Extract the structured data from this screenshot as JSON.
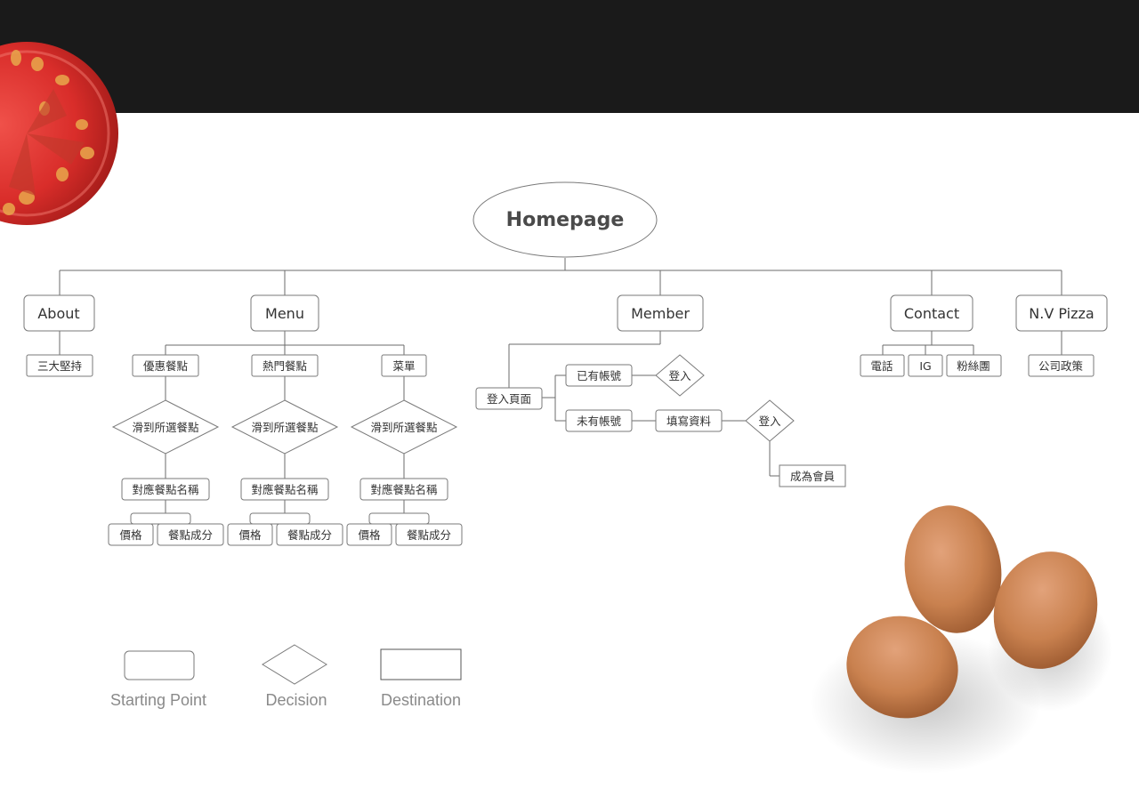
{
  "title": "Homepage",
  "top_nav": [
    {
      "key": "about",
      "label": "About"
    },
    {
      "key": "menu",
      "label": "Menu"
    },
    {
      "key": "member",
      "label": "Member"
    },
    {
      "key": "contact",
      "label": "Contact"
    },
    {
      "key": "nvpizza",
      "label": "N.V Pizza"
    }
  ],
  "about": {
    "items": [
      "三大堅持"
    ]
  },
  "menu": {
    "columns": [
      {
        "category": "優惠餐點",
        "decision": "滑到所選餐點",
        "name_box": "對應餐點名稱",
        "price": "價格",
        "ingredients": "餐點成分"
      },
      {
        "category": "熱門餐點",
        "decision": "滑到所選餐點",
        "name_box": "對應餐點名稱",
        "price": "價格",
        "ingredients": "餐點成分"
      },
      {
        "category": "菜單",
        "decision": "滑到所選餐點",
        "name_box": "對應餐點名稱",
        "price": "價格",
        "ingredients": "餐點成分"
      }
    ]
  },
  "member": {
    "login_page": "登入頁面",
    "has_account": "已有帳號",
    "login_decision_1": "登入",
    "no_account": "未有帳號",
    "fill_info": "填寫資料",
    "login_decision_2": "登入",
    "become_member": "成為會員"
  },
  "contact": {
    "items": [
      "電話",
      "IG",
      "粉絲團"
    ]
  },
  "nvpizza": {
    "items": [
      "公司政策"
    ]
  },
  "legend": {
    "starting_point": "Starting Point",
    "decision": "Decision",
    "destination": "Destination"
  },
  "colors": {
    "topbar": "#1a1a1a",
    "line": "#6b6b6b",
    "node_stroke": "#7a7a7a",
    "text": "#333333",
    "legend_text": "#8a8a8a"
  }
}
